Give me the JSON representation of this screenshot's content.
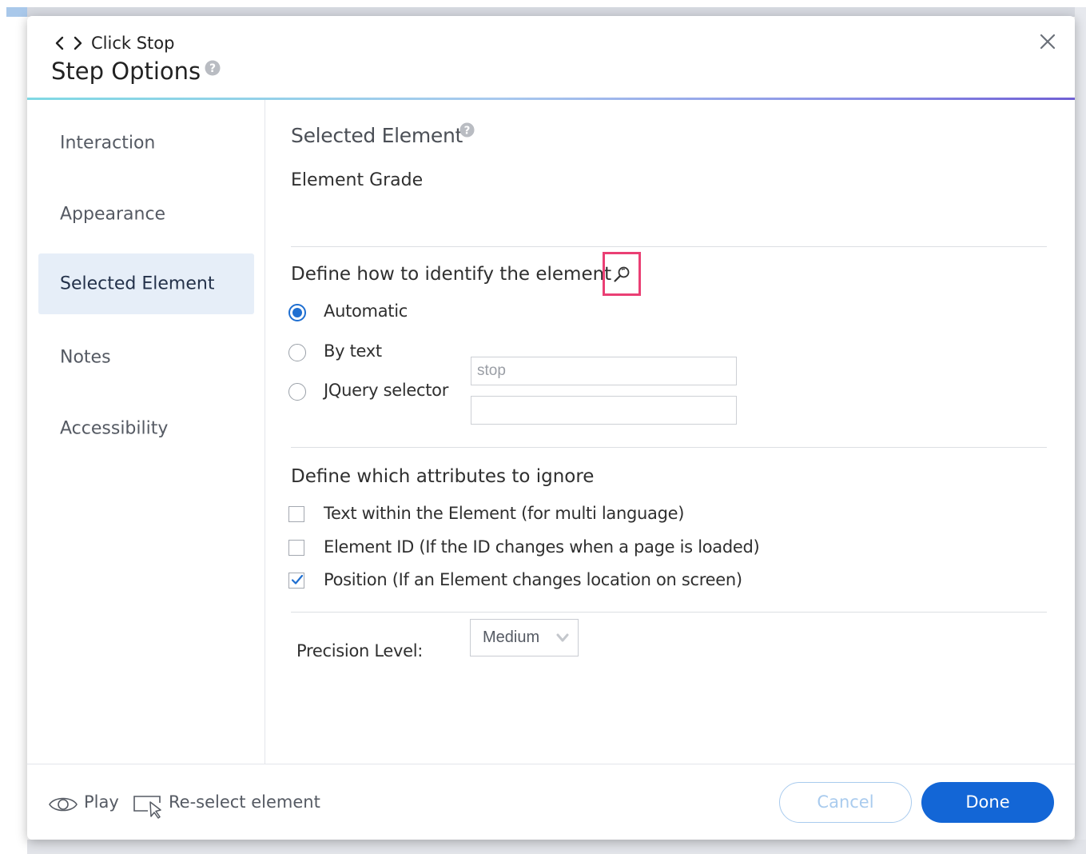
{
  "header": {
    "step_name": "Click Stop",
    "title": "Step Options"
  },
  "sidebar": {
    "items": [
      {
        "label": "Interaction",
        "active": false
      },
      {
        "label": "Appearance",
        "active": false
      },
      {
        "label": "Selected Element",
        "active": true
      },
      {
        "label": "Notes",
        "active": false
      },
      {
        "label": "Accessibility",
        "active": false
      }
    ]
  },
  "main": {
    "section_title": "Selected Element",
    "grade_label": "Element Grade",
    "identify": {
      "label": "Define how to identify the element",
      "options": [
        {
          "label": "Automatic",
          "selected": true
        },
        {
          "label": "By text",
          "selected": false,
          "input_value": "stop"
        },
        {
          "label": "JQuery selector",
          "selected": false,
          "input_value": ""
        }
      ]
    },
    "ignore": {
      "label": "Define which attributes to ignore",
      "options": [
        {
          "label": "Text within the Element (for multi language)",
          "checked": false
        },
        {
          "label": "Element ID (If the ID changes when a page is loaded)",
          "checked": false
        },
        {
          "label": "Position (If an Element changes location on screen)",
          "checked": true
        }
      ]
    },
    "precision": {
      "label": "Precision Level:",
      "value": "Medium"
    }
  },
  "footer": {
    "play_label": "Play",
    "reselect_label": "Re-select element",
    "cancel_label": "Cancel",
    "done_label": "Done"
  },
  "colors": {
    "accent_blue": "#1366d6",
    "highlight_pink": "#ea3f74",
    "active_nav_bg": "#e6eef8"
  },
  "icons": [
    "chevron-left-icon",
    "chevron-right-icon",
    "help-icon",
    "close-icon",
    "magnifier-icon",
    "chevron-down-icon",
    "eye-icon",
    "cursor-select-icon",
    "checkmark-icon"
  ]
}
